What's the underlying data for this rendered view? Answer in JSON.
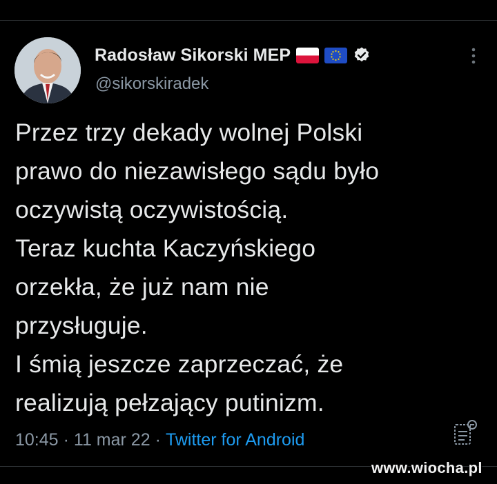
{
  "author": {
    "display_name": "Radosław Sikorski MEP",
    "handle": "@sikorskiradek",
    "flags": [
      "poland-flag-icon",
      "eu-flag-icon"
    ],
    "verified_icon": "verified-badge-icon"
  },
  "tweet": {
    "lines": [
      "Przez trzy dekady wolnej Polski",
      "prawo do niezawisłego sądu było",
      "oczywistą oczywistością.",
      "Teraz kuchta Kaczyńskiego",
      "orzekła, że już nam nie",
      "przysługuje.",
      "I śmią jeszcze zaprzeczać, że",
      "realizują pełzający putinizm."
    ]
  },
  "meta": {
    "time": "10:45",
    "separator": "·",
    "date": "11 mar 22",
    "source": "Twitter for Android"
  },
  "watermark": "www.wiocha.pl",
  "colors": {
    "background": "#000000",
    "text": "#e7e9ea",
    "secondary": "#8b98a5",
    "link": "#1d9bf0"
  }
}
